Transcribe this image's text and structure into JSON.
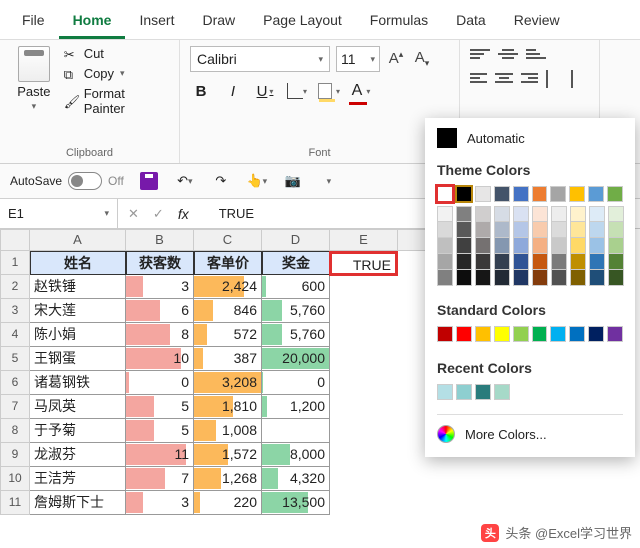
{
  "tabs": [
    "File",
    "Home",
    "Insert",
    "Draw",
    "Page Layout",
    "Formulas",
    "Data",
    "Review"
  ],
  "active_tab": "Home",
  "clipboard": {
    "paste": "Paste",
    "cut": "Cut",
    "copy": "Copy",
    "painter": "Format Painter",
    "label": "Clipboard"
  },
  "font": {
    "name": "Calibri",
    "size": "11",
    "label": "Font"
  },
  "qat": {
    "autosave": "AutoSave",
    "off": "Off"
  },
  "namebox": "E1",
  "formula": "TRUE",
  "headers": {
    "a": "姓名",
    "b": "获客数",
    "c": "客单价",
    "d": "奖金",
    "e": "TRUE"
  },
  "rows": [
    {
      "a": "赵铁锤",
      "b": "3",
      "c": "2,424",
      "d": "600",
      "rb": 25,
      "ob": 75,
      "gb": 6
    },
    {
      "a": "宋大莲",
      "b": "6",
      "c": "846",
      "d": "5,760",
      "rb": 50,
      "ob": 28,
      "gb": 30
    },
    {
      "a": "陈小娟",
      "b": "8",
      "c": "572",
      "d": "5,760",
      "rb": 65,
      "ob": 20,
      "gb": 30
    },
    {
      "a": "王钢蛋",
      "b": "10",
      "c": "387",
      "d": "20,000",
      "rb": 82,
      "ob": 14,
      "gb": 100
    },
    {
      "a": "诸葛钢铁",
      "b": "0",
      "c": "3,208",
      "d": "0",
      "rb": 4,
      "ob": 100,
      "gb": 2
    },
    {
      "a": "马凤英",
      "b": "5",
      "c": "1,810",
      "d": "1,200",
      "rb": 42,
      "ob": 58,
      "gb": 8
    },
    {
      "a": "于予菊",
      "b": "5",
      "c": "1,008",
      "d": "",
      "rb": 42,
      "ob": 33,
      "gb": 0
    },
    {
      "a": "龙淑芬",
      "b": "11",
      "c": "1,572",
      "d": "8,000",
      "rb": 90,
      "ob": 50,
      "gb": 42
    },
    {
      "a": "王洁芳",
      "b": "7",
      "c": "1,268",
      "d": "4,320",
      "rb": 58,
      "ob": 41,
      "gb": 24
    },
    {
      "a": "詹姆斯下士",
      "b": "3",
      "c": "220",
      "d": "13,500",
      "rb": 25,
      "ob": 9,
      "gb": 68
    }
  ],
  "colorpop": {
    "auto": "Automatic",
    "theme": "Theme Colors",
    "standard": "Standard Colors",
    "recent": "Recent Colors",
    "more": "More Colors...",
    "theme_row": [
      "#ffffff",
      "#000000",
      "#e7e6e6",
      "#44546a",
      "#4472c4",
      "#ed7d31",
      "#a5a5a5",
      "#ffc000",
      "#5b9bd5",
      "#70ad47"
    ],
    "shades": [
      [
        "#f2f2f2",
        "#d9d9d9",
        "#bfbfbf",
        "#a6a6a6",
        "#808080"
      ],
      [
        "#808080",
        "#595959",
        "#404040",
        "#262626",
        "#0d0d0d"
      ],
      [
        "#d0cece",
        "#aeaaaa",
        "#757171",
        "#3a3838",
        "#161616"
      ],
      [
        "#d6dce5",
        "#adb9ca",
        "#8497b0",
        "#333f50",
        "#222a35"
      ],
      [
        "#d9e1f2",
        "#b4c6e7",
        "#8ea9db",
        "#305496",
        "#203764"
      ],
      [
        "#fce4d6",
        "#f8cbad",
        "#f4b084",
        "#c65911",
        "#833c0c"
      ],
      [
        "#ededed",
        "#dbdbdb",
        "#c9c9c9",
        "#7b7b7b",
        "#525252"
      ],
      [
        "#fff2cc",
        "#ffe699",
        "#ffd966",
        "#bf8f00",
        "#806000"
      ],
      [
        "#ddebf7",
        "#bdd7ee",
        "#9bc2e6",
        "#2f75b5",
        "#1f4e78"
      ],
      [
        "#e2efda",
        "#c6e0b4",
        "#a9d08e",
        "#548235",
        "#375623"
      ]
    ],
    "standard_row": [
      "#c00000",
      "#ff0000",
      "#ffc000",
      "#ffff00",
      "#92d050",
      "#00b050",
      "#00b0f0",
      "#0070c0",
      "#002060",
      "#7030a0"
    ],
    "recent_row": [
      "#b4dfe5",
      "#8ecfd0",
      "#2a7c7c",
      "#a6d9c8"
    ]
  },
  "watermark": "头条 @Excel学习世界",
  "chart_data": {
    "type": "table",
    "title": "",
    "columns": [
      "姓名",
      "获客数",
      "客单价",
      "奖金"
    ],
    "rows": [
      [
        "赵铁锤",
        3,
        2424,
        600
      ],
      [
        "宋大莲",
        6,
        846,
        5760
      ],
      [
        "陈小娟",
        8,
        572,
        5760
      ],
      [
        "王钢蛋",
        10,
        387,
        20000
      ],
      [
        "诸葛钢铁",
        0,
        3208,
        0
      ],
      [
        "马凤英",
        5,
        1810,
        1200
      ],
      [
        "于予菊",
        5,
        1008,
        null
      ],
      [
        "龙淑芬",
        11,
        1572,
        8000
      ],
      [
        "王洁芳",
        7,
        1268,
        4320
      ],
      [
        "詹姆斯下士",
        3,
        220,
        13500
      ]
    ]
  }
}
